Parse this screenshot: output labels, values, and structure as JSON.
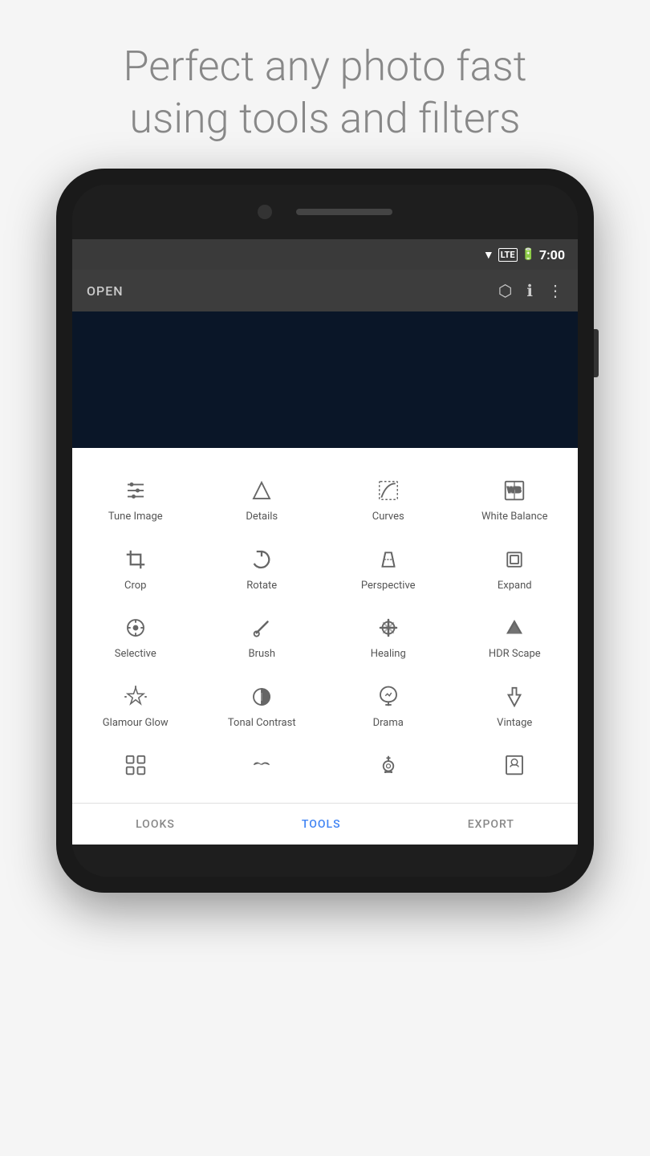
{
  "header": {
    "line1": "Perfect any photo fast",
    "line2": "using tools and filters"
  },
  "status": {
    "time": "7:00"
  },
  "toolbar": {
    "open_label": "OPEN"
  },
  "tools": [
    {
      "id": "tune-image",
      "label": "Tune Image",
      "icon": "tune"
    },
    {
      "id": "details",
      "label": "Details",
      "icon": "details"
    },
    {
      "id": "curves",
      "label": "Curves",
      "icon": "curves"
    },
    {
      "id": "white-balance",
      "label": "White Balance",
      "icon": "wb"
    },
    {
      "id": "crop",
      "label": "Crop",
      "icon": "crop"
    },
    {
      "id": "rotate",
      "label": "Rotate",
      "icon": "rotate"
    },
    {
      "id": "perspective",
      "label": "Perspective",
      "icon": "perspective"
    },
    {
      "id": "expand",
      "label": "Expand",
      "icon": "expand"
    },
    {
      "id": "selective",
      "label": "Selective",
      "icon": "selective"
    },
    {
      "id": "brush",
      "label": "Brush",
      "icon": "brush"
    },
    {
      "id": "healing",
      "label": "Healing",
      "icon": "healing"
    },
    {
      "id": "hdr-scape",
      "label": "HDR Scape",
      "icon": "hdr"
    },
    {
      "id": "glamour-glow",
      "label": "Glamour Glow",
      "icon": "glamour"
    },
    {
      "id": "tonal-contrast",
      "label": "Tonal Contrast",
      "icon": "tonal"
    },
    {
      "id": "drama",
      "label": "Drama",
      "icon": "drama"
    },
    {
      "id": "vintage",
      "label": "Vintage",
      "icon": "vintage"
    },
    {
      "id": "looks",
      "label": "",
      "icon": "looks-grid"
    },
    {
      "id": "moustache",
      "label": "",
      "icon": "moustache"
    },
    {
      "id": "guitar",
      "label": "",
      "icon": "guitar"
    },
    {
      "id": "portrait",
      "label": "",
      "icon": "portrait"
    }
  ],
  "nav": {
    "looks": "LOOKS",
    "tools": "TOOLS",
    "export": "EXPORT"
  }
}
